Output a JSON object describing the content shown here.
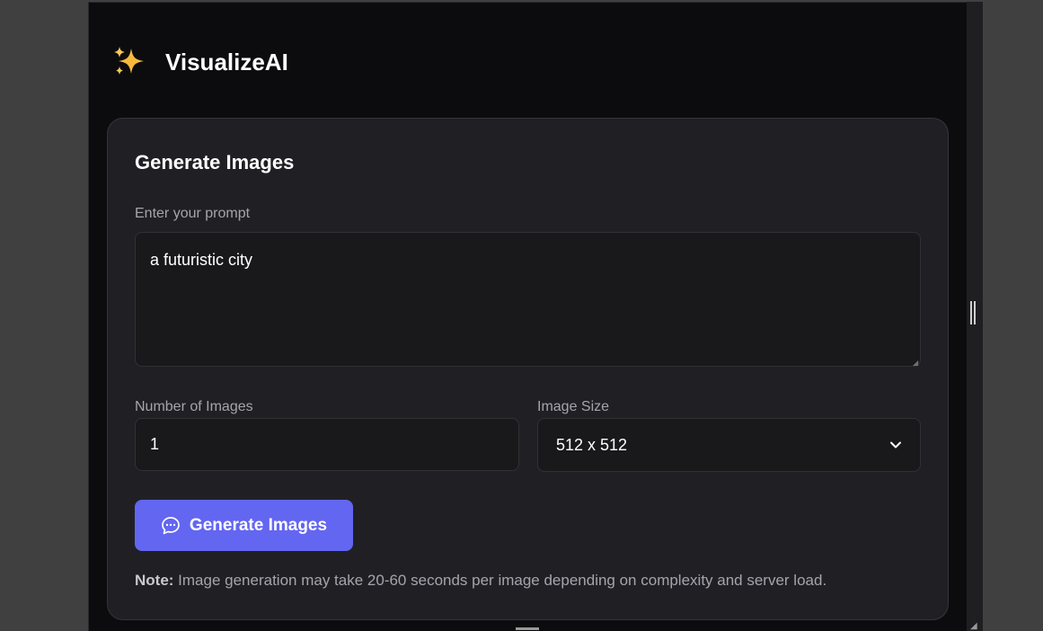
{
  "app": {
    "logo_icon": "sparkles-icon",
    "name": "VisualizeAI"
  },
  "card": {
    "title": "Generate Images",
    "prompt": {
      "label": "Enter your prompt",
      "value": "a futuristic city"
    },
    "num_images": {
      "label": "Number of Images",
      "value": "1"
    },
    "image_size": {
      "label": "Image Size",
      "selected": "512 x 512"
    },
    "generate_button": {
      "icon": "chat-bubble-icon",
      "label": "Generate Images"
    },
    "note": {
      "strong": "Note:",
      "text": " Image generation may take 20-60 seconds per image depending on complexity and server load."
    }
  },
  "colors": {
    "accent": "#6366f1",
    "background": "#0c0c0f",
    "card": "#202024",
    "input": "#19191c"
  }
}
